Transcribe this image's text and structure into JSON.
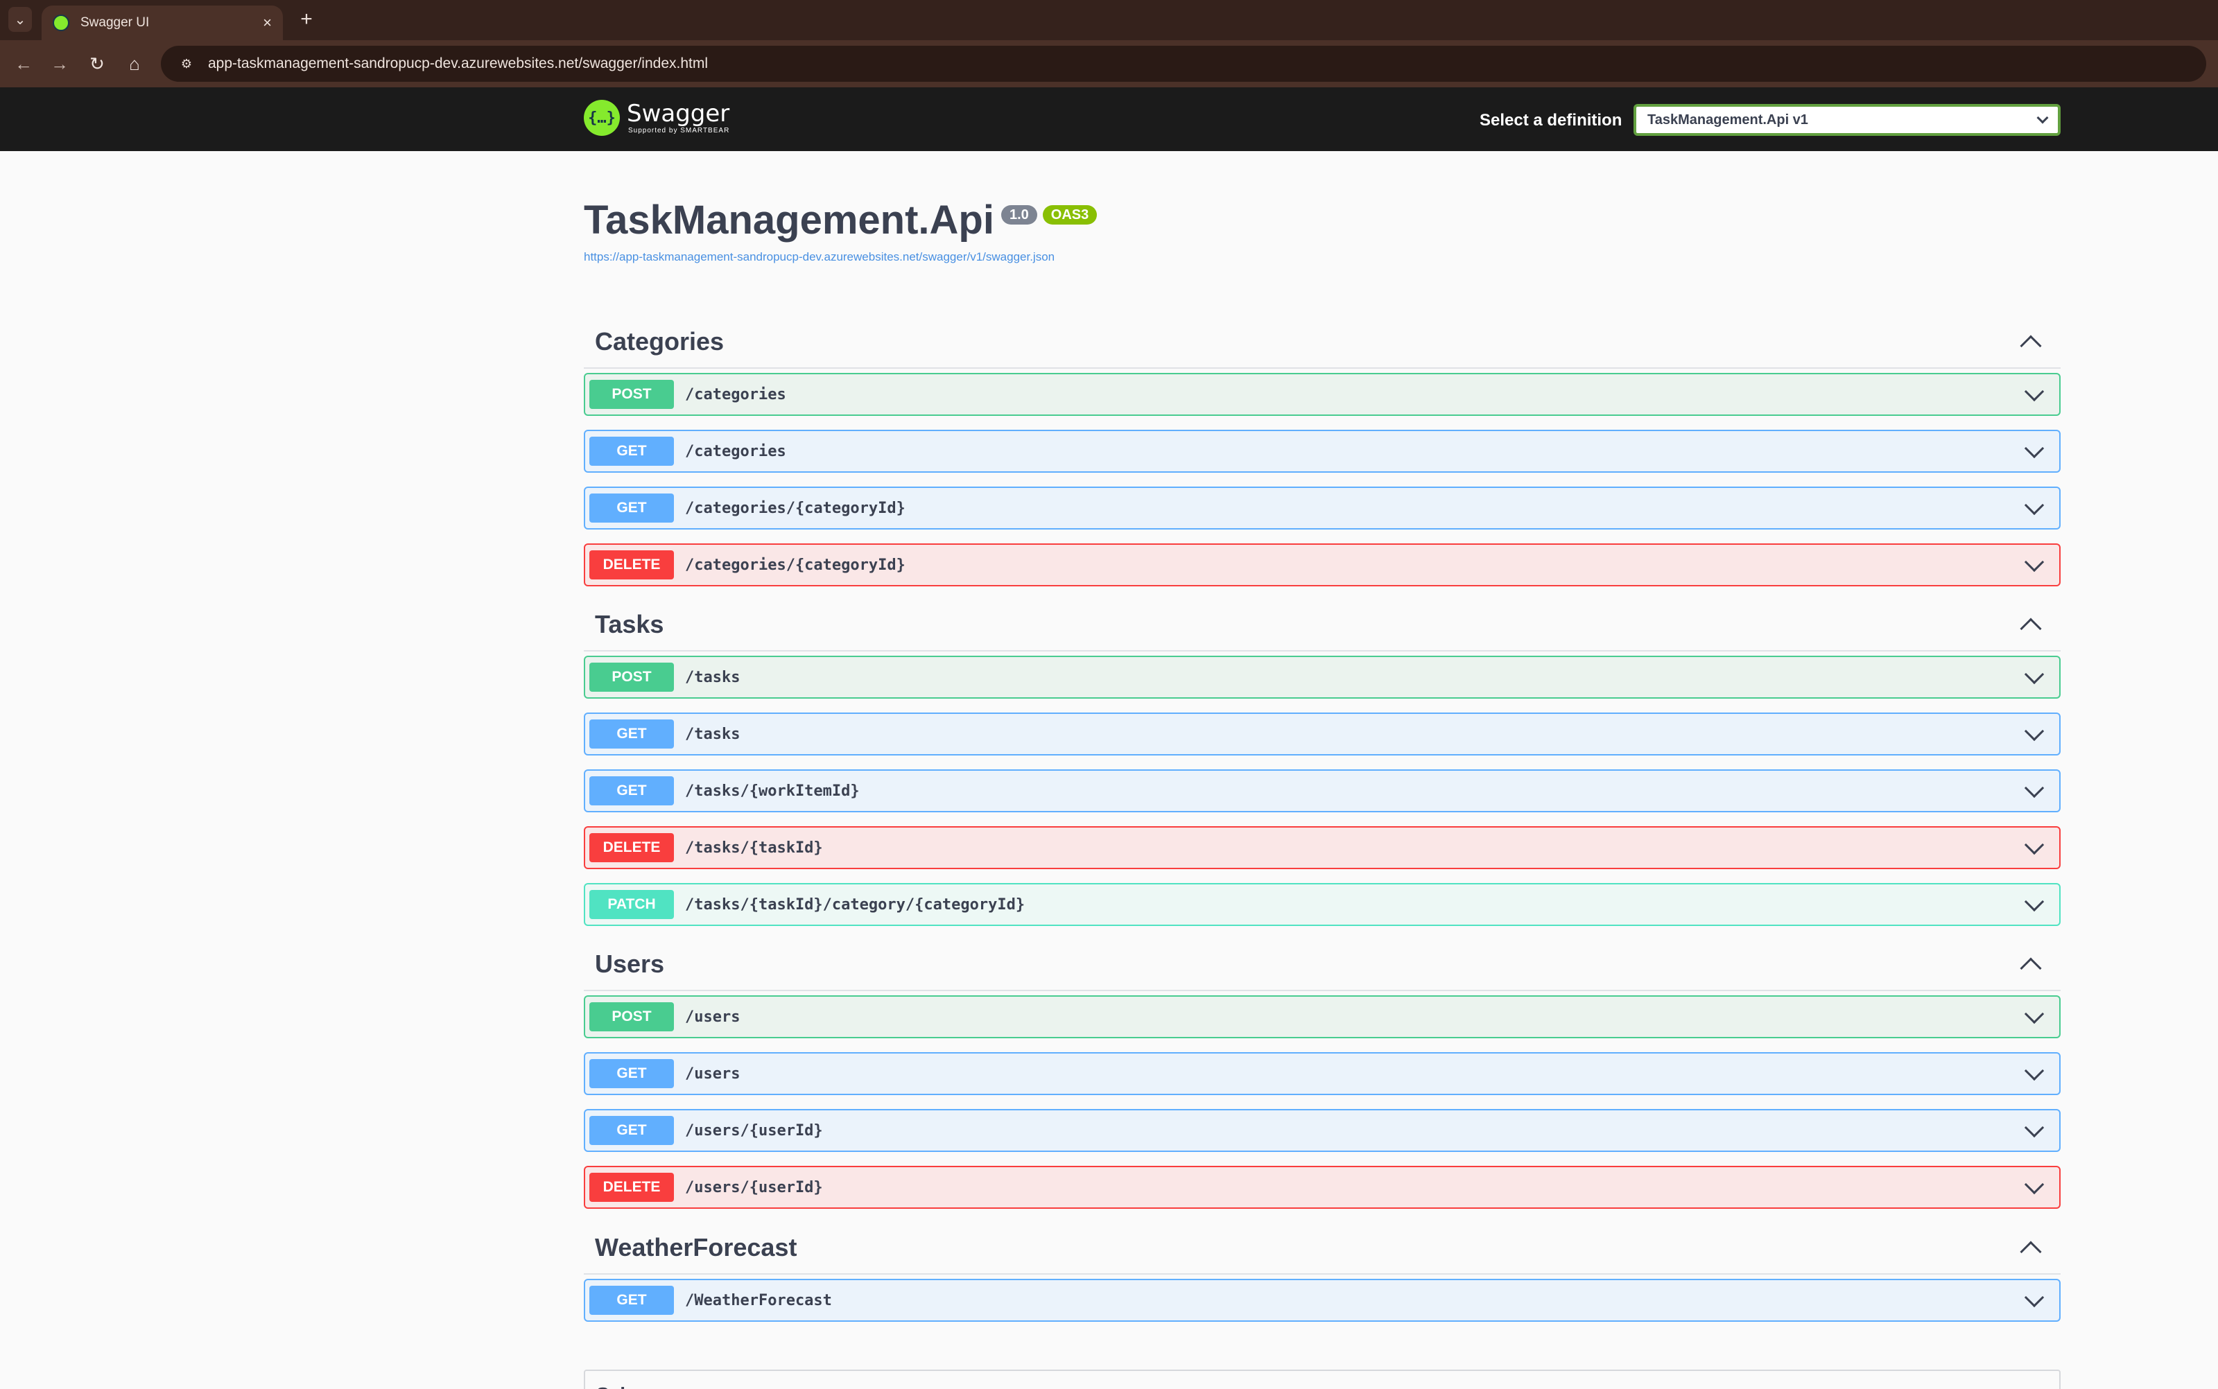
{
  "browser": {
    "tab_title": "Swagger UI",
    "tab_close": "×",
    "new_tab": "+",
    "url": "app-taskmanagement-sandropucp-dev.azurewebsites.net/swagger/index.html"
  },
  "topbar": {
    "logo_title": "Swagger",
    "logo_sub": "Supported by SMARTBEAR",
    "definition_label": "Select a definition",
    "definition_value": "TaskManagement.Api v1"
  },
  "info": {
    "title": "TaskManagement.Api",
    "version": "1.0",
    "oas": "OAS3",
    "spec_url": "https://app-taskmanagement-sandropucp-dev.azurewebsites.net/swagger/v1/swagger.json"
  },
  "sections": [
    {
      "name": "Categories",
      "operations": [
        {
          "method": "POST",
          "path": "/categories"
        },
        {
          "method": "GET",
          "path": "/categories"
        },
        {
          "method": "GET",
          "path": "/categories/{categoryId}"
        },
        {
          "method": "DELETE",
          "path": "/categories/{categoryId}"
        }
      ]
    },
    {
      "name": "Tasks",
      "operations": [
        {
          "method": "POST",
          "path": "/tasks"
        },
        {
          "method": "GET",
          "path": "/tasks"
        },
        {
          "method": "GET",
          "path": "/tasks/{workItemId}"
        },
        {
          "method": "DELETE",
          "path": "/tasks/{taskId}"
        },
        {
          "method": "PATCH",
          "path": "/tasks/{taskId}/category/{categoryId}"
        }
      ]
    },
    {
      "name": "Users",
      "operations": [
        {
          "method": "POST",
          "path": "/users"
        },
        {
          "method": "GET",
          "path": "/users"
        },
        {
          "method": "GET",
          "path": "/users/{userId}"
        },
        {
          "method": "DELETE",
          "path": "/users/{userId}"
        }
      ]
    },
    {
      "name": "WeatherForecast",
      "operations": [
        {
          "method": "GET",
          "path": "/WeatherForecast"
        }
      ]
    }
  ],
  "schemas": {
    "title": "Schemas"
  },
  "colors": {
    "post": "#49cc90",
    "get": "#61affe",
    "delete": "#f93e3e",
    "patch": "#50e3c2",
    "topbar": "#1b1b1b",
    "swagger_green": "#85ea2d"
  }
}
